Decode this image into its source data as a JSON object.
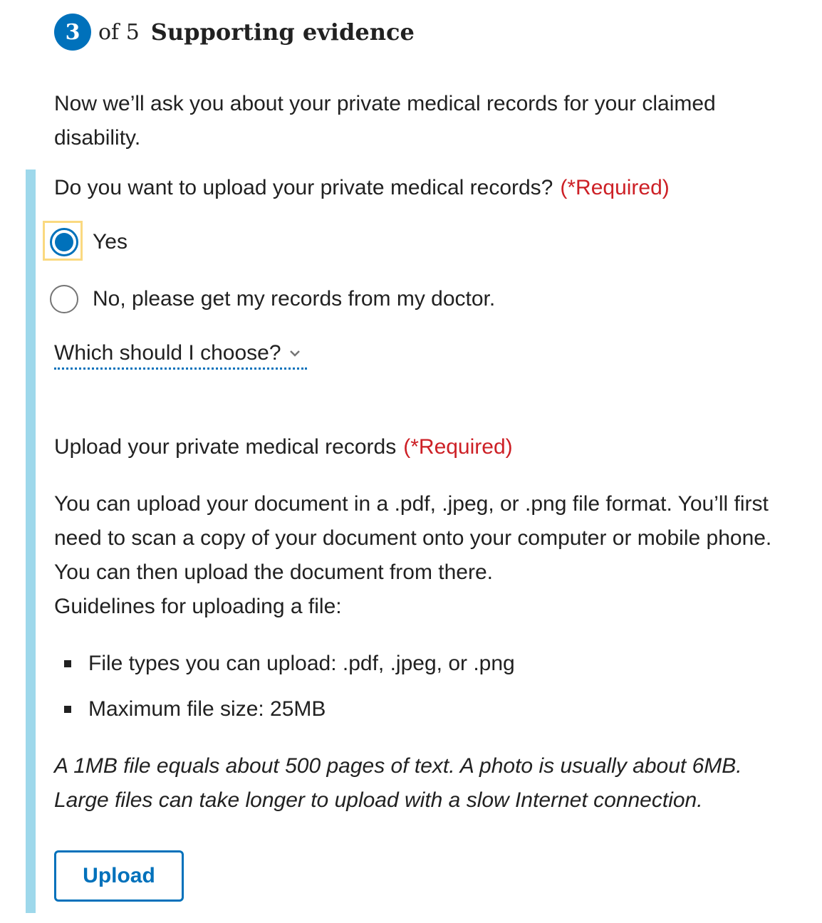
{
  "step": {
    "number": "3",
    "of_text": "of 5",
    "title": "Supporting evidence"
  },
  "intro": "Now we’ll ask you about your private medical records for your claimed disability.",
  "question": {
    "text": "Do you want to upload your private medical records?",
    "required": "(*Required)"
  },
  "options": [
    {
      "label": "Yes",
      "selected": true
    },
    {
      "label": "No, please get my records from my doctor.",
      "selected": false
    }
  ],
  "help_link": "Which should I choose?",
  "upload": {
    "label": "Upload your private medical records",
    "required": "(*Required)",
    "description_lines": [
      "You can upload your document in a .pdf, .jpeg, or .png file format. You’ll first",
      "need to scan a copy of your document onto your computer or mobile phone.",
      "You can then upload the document from there.",
      "Guidelines for uploading a file:"
    ],
    "guidelines": [
      "File types you can upload: .pdf, .jpeg, or .png",
      "Maximum file size: 25MB"
    ],
    "note": "A 1MB file equals about 500 pages of text. A photo is usually about 6MB. Large files can take longer to upload with a slow Internet connection.",
    "button_label": "Upload"
  },
  "colors": {
    "primary": "#0071bb",
    "required": "#cd2026",
    "accent_bar": "#9ed8eb",
    "focus": "#fad980"
  }
}
